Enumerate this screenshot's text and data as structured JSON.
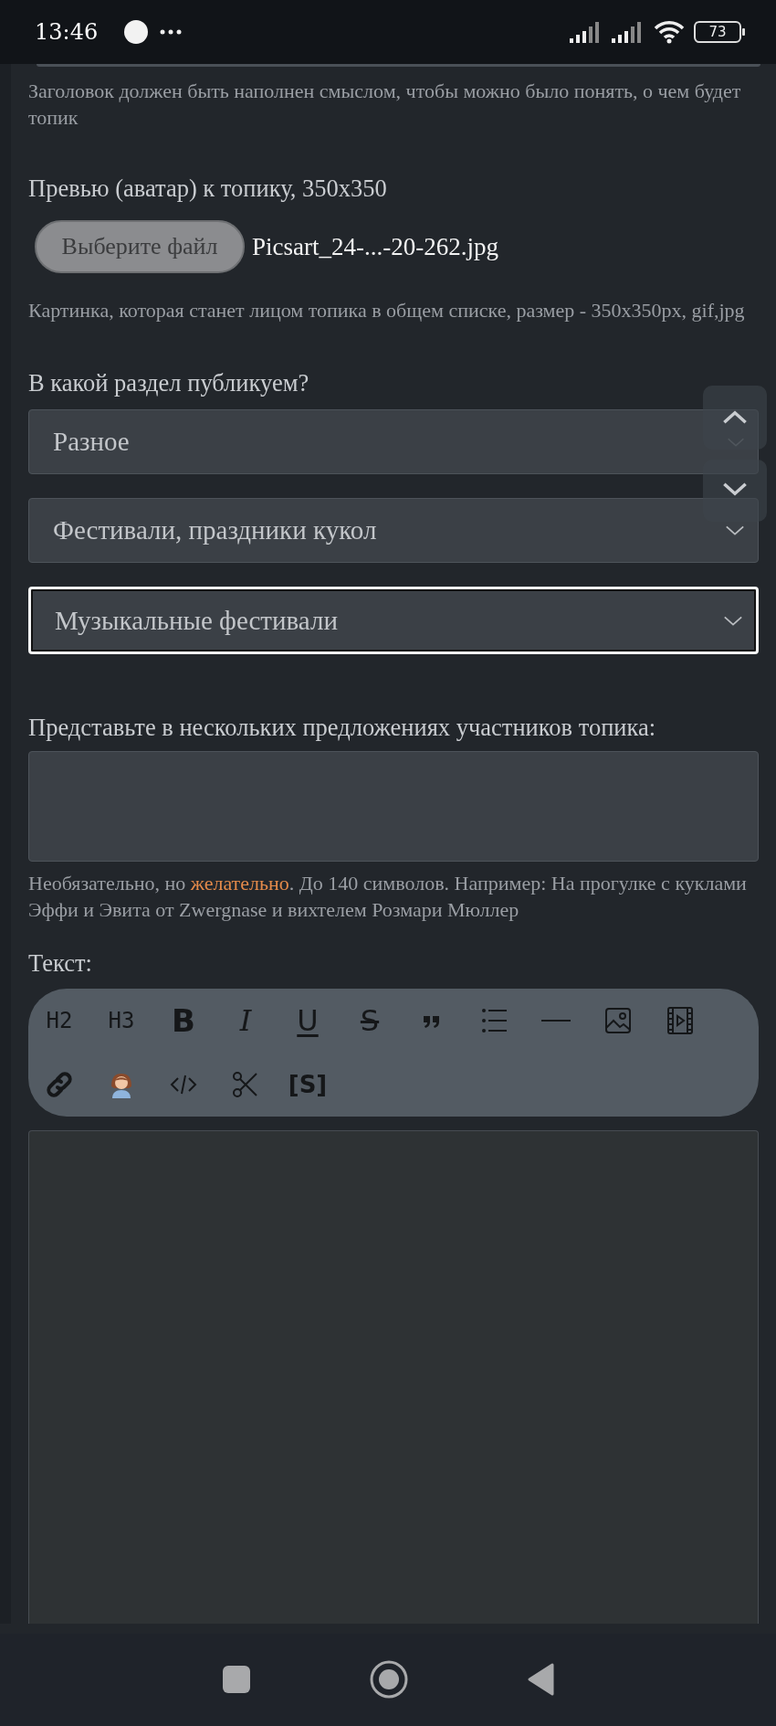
{
  "status_bar": {
    "time": "13:46",
    "battery": "73"
  },
  "title_hint": "Заголовок должен быть наполнен смыслом, чтобы можно было понять, о чем будет топик",
  "preview": {
    "label": "Превью (аватар) к топику, 350x350",
    "button": "Выберите файл",
    "file_name": "Picsart_24-...-20-262.jpg",
    "hint": "Картинка, которая станет лицом топика в общем списке, размер - 350x350px, gif,jpg"
  },
  "section": {
    "label": "В какой раздел публикуем?",
    "selects": [
      {
        "value": "Разное",
        "focused": false
      },
      {
        "value": "Фестивали, праздники кукол",
        "focused": false
      },
      {
        "value": "Музыкальные фестивали",
        "focused": true
      }
    ]
  },
  "participants": {
    "label": "Представьте в нескольких предложениях участников топика:",
    "hint": "Необязательно, но **желательно**. До 140 символов. Например: На прогулке с куклами Эффи и Эвита от Zwergnase и вихтелем Розмари Мюллер"
  },
  "text": {
    "label": "Текст:",
    "toolbar": [
      {
        "kind": "text",
        "label": "H2"
      },
      {
        "kind": "text",
        "label": "H3"
      },
      {
        "kind": "bold",
        "label": "B"
      },
      {
        "kind": "italic",
        "label": "I"
      },
      {
        "kind": "underline",
        "label": "U"
      },
      {
        "kind": "strike",
        "label": "S"
      },
      {
        "kind": "quote"
      },
      {
        "kind": "list"
      },
      {
        "kind": "rule"
      },
      {
        "kind": "image"
      },
      {
        "kind": "video"
      },
      {
        "kind": "link"
      },
      {
        "kind": "user"
      },
      {
        "kind": "code"
      },
      {
        "kind": "cut"
      },
      {
        "kind": "spoiler",
        "label": "[S]"
      }
    ]
  }
}
